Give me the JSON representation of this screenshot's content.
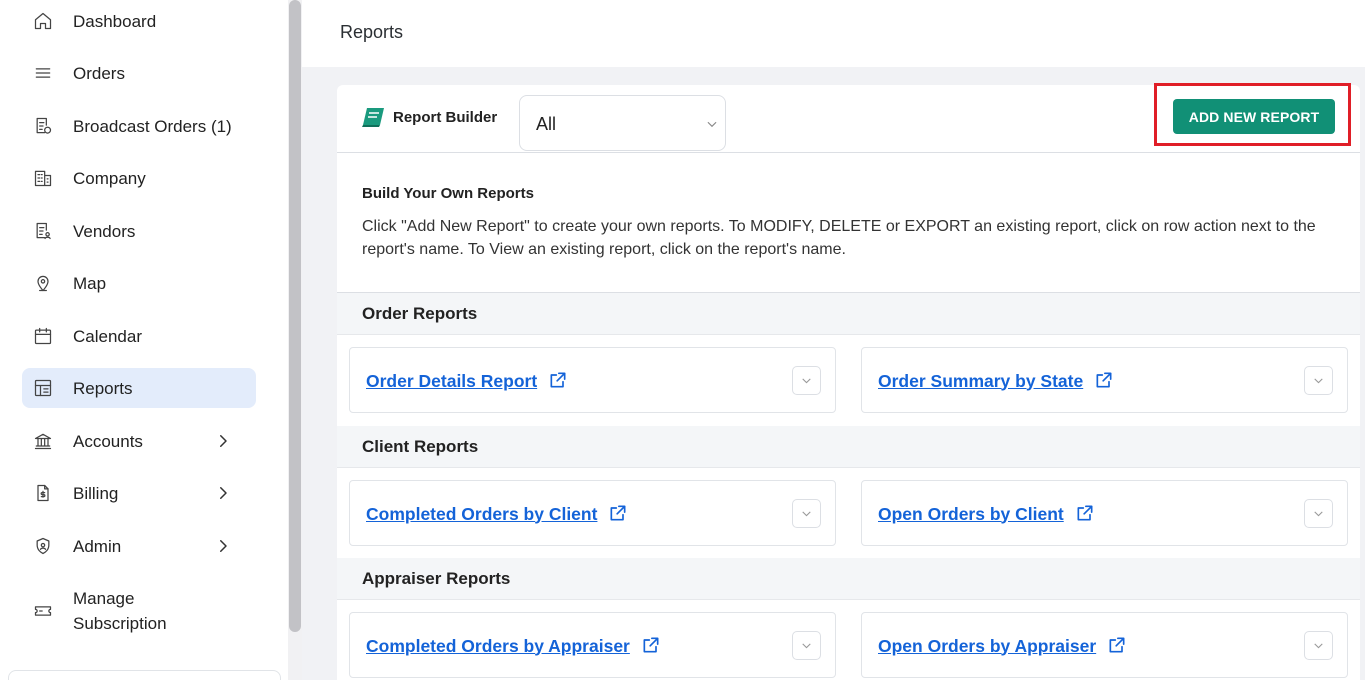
{
  "sidebar": {
    "items": [
      {
        "label": "Dashboard",
        "icon": "home-icon"
      },
      {
        "label": "Orders",
        "icon": "list-icon"
      },
      {
        "label": "Broadcast Orders (1)",
        "icon": "broadcast-doc-icon"
      },
      {
        "label": "Company",
        "icon": "building-icon"
      },
      {
        "label": "Vendors",
        "icon": "vendor-doc-icon"
      },
      {
        "label": "Map",
        "icon": "map-pin-icon"
      },
      {
        "label": "Calendar",
        "icon": "calendar-icon"
      },
      {
        "label": "Reports",
        "icon": "reports-icon",
        "active": true
      },
      {
        "label": "Accounts",
        "icon": "bank-icon",
        "expandable": true
      },
      {
        "label": "Billing",
        "icon": "billing-icon",
        "expandable": true
      },
      {
        "label": "Admin",
        "icon": "shield-icon",
        "expandable": true
      },
      {
        "label": "Manage\nSubscription",
        "icon": "ticket-icon"
      }
    ]
  },
  "header": {
    "title": "Reports"
  },
  "toolbar": {
    "report_builder_label": "Report Builder",
    "filter_value": "All",
    "add_button_label": "ADD NEW REPORT"
  },
  "intro": {
    "title": "Build Your Own Reports",
    "text": "Click \"Add New Report\" to create your own reports. To MODIFY, DELETE or EXPORT an existing report, click on row action next to the report's name. To View an existing report, click on the report's name."
  },
  "sections": [
    {
      "title": "Order Reports",
      "reports": [
        "Order Details Report",
        "Order Summary by State"
      ]
    },
    {
      "title": "Client Reports",
      "reports": [
        "Completed Orders by Client",
        "Open Orders by Client"
      ]
    },
    {
      "title": "Appraiser Reports",
      "reports": [
        "Completed Orders by Appraiser",
        "Open Orders by Appraiser"
      ]
    }
  ],
  "colors": {
    "accent": "#119076",
    "link": "#1463d8",
    "highlight": "#e01e27",
    "active_bg": "#e3ecfb"
  }
}
